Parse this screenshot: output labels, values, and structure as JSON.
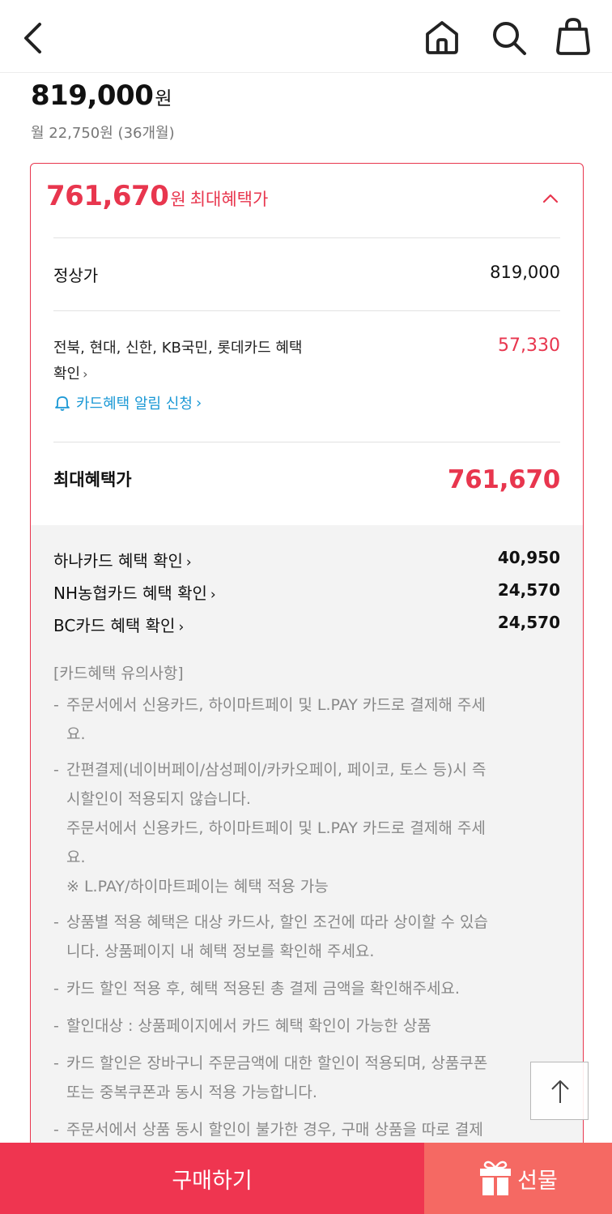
{
  "header": {
    "back_icon": "chevron-left-icon",
    "home_icon": "home-icon",
    "search_icon": "search-icon",
    "bag_icon": "shopping-bag-icon"
  },
  "product": {
    "price": "819,000",
    "price_unit": "원",
    "monthly": "월 22,750원 (36개월)"
  },
  "benefit": {
    "max_price": "761,670",
    "max_price_unit": "원",
    "max_price_label": "최대혜택가",
    "accent_color": "#e8364e",
    "regular_label": "정상가",
    "regular_value": "819,000",
    "card_line1": "전북, 현대, 신한, KB국민, 롯데카드 혜택",
    "card_line2": "확인",
    "card_discount": "57,330",
    "alert_link": "카드혜택 알림 신청",
    "max_label": "최대혜택가",
    "max_value": "761,670"
  },
  "other_cards": [
    {
      "label": "하나카드 혜택 확인",
      "value": "40,950"
    },
    {
      "label": "NH농협카드 혜택 확인",
      "value": "24,570"
    },
    {
      "label": "BC카드 혜택 확인",
      "value": "24,570"
    }
  ],
  "notices": {
    "title": "[카드혜택 유의사항]",
    "items": [
      {
        "line1": "주문서에서 신용카드, 하이마트페이 및 L.PAY 카드로 결제해 주세",
        "line2": "요."
      },
      {
        "line1": "간편결제(네이버페이/삼성페이/카카오페이, 페이코, 토스 등)시 즉",
        "line2": "시할인이 적용되지 않습니다.",
        "line3": "주문서에서 신용카드, 하이마트페이 및 L.PAY 카드로 결제해 주세",
        "line4": "요.",
        "line5": "※ L.PAY/하이마트페이는 혜택 적용 가능"
      },
      {
        "line1": "상품별 적용 혜택은 대상 카드사, 할인 조건에 따라 상이할 수 있습",
        "line2": "니다. 상품페이지 내 혜택 정보를 확인해 주세요."
      },
      {
        "line1": "카드 할인 적용 후, 혜택 적용된 총 결제 금액을 확인해주세요."
      },
      {
        "line1": "할인대상 : 상품페이지에서 카드 혜택 확인이 가능한 상품"
      },
      {
        "line1": "카드 할인은 장바구니 주문금액에 대한 할인이 적용되며, 상품쿠폰",
        "line2": "또는 중복쿠폰과 동시 적용 가능합니다."
      },
      {
        "line1": "주문서에서 상품 동시 할인이 불가한 경우, 구매 상품을 따로 결제"
      }
    ]
  },
  "actions": {
    "buy_label": "구매하기",
    "gift_label": "선물",
    "buy_color": "#ef3550",
    "gift_color": "#f56963",
    "scroll_top_icon": "arrow-up-icon"
  }
}
